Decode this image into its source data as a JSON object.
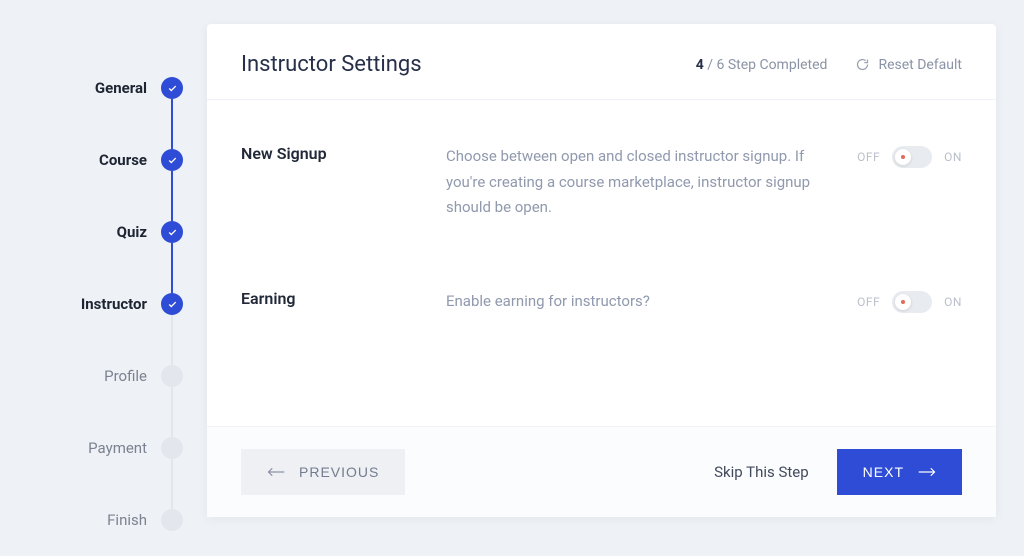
{
  "sidebar": {
    "steps": [
      {
        "label": "General",
        "state": "done"
      },
      {
        "label": "Course",
        "state": "done"
      },
      {
        "label": "Quiz",
        "state": "done"
      },
      {
        "label": "Instructor",
        "state": "current"
      },
      {
        "label": "Profile",
        "state": "pending"
      },
      {
        "label": "Payment",
        "state": "pending"
      },
      {
        "label": "Finish",
        "state": "pending"
      }
    ]
  },
  "header": {
    "title": "Instructor Settings",
    "progress_current": "4",
    "progress_total_text": " / 6 Step Completed",
    "reset_label": "Reset Default"
  },
  "settings": [
    {
      "name": "New Signup",
      "desc": "Choose between open and closed instructor signup. If you're creating a course marketplace, instructor signup should be open.",
      "off_label": "OFF",
      "on_label": "ON",
      "value": "off"
    },
    {
      "name": "Earning",
      "desc": "Enable earning for instructors?",
      "off_label": "OFF",
      "on_label": "ON",
      "value": "off"
    }
  ],
  "footer": {
    "prev_label": "PREVIOUS",
    "skip_label": "Skip This Step",
    "next_label": "NEXT"
  }
}
